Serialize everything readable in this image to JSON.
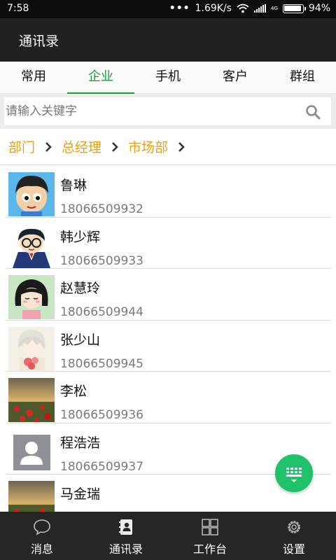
{
  "status_bar": {
    "time": "7:58",
    "dots": "•••",
    "speed": "1.69K/s",
    "network": "4G",
    "battery_text": "94%",
    "battery_level": 0.94
  },
  "header": {
    "title": "通讯录"
  },
  "tabs": [
    {
      "label": "常用",
      "active": false
    },
    {
      "label": "企业",
      "active": true
    },
    {
      "label": "手机",
      "active": false
    },
    {
      "label": "客户",
      "active": false
    },
    {
      "label": "群组",
      "active": false
    }
  ],
  "search": {
    "placeholder": "请输入关键字",
    "value": "",
    "icon": "search-icon"
  },
  "breadcrumb": {
    "items": [
      "部门",
      "总经理",
      "市场部"
    ],
    "separator_icon": "chevron-right-icon",
    "color": "#e6a118"
  },
  "contacts": [
    {
      "name": "鲁琳",
      "phone": "18066509932",
      "avatar": "cartoon-boy-avatar"
    },
    {
      "name": "韩少辉",
      "phone": "18066509933",
      "avatar": "cartoon-detective-avatar"
    },
    {
      "name": "赵慧玲",
      "phone": "18066509944",
      "avatar": "cartoon-girl-avatar"
    },
    {
      "name": "张少山",
      "phone": "18066509945",
      "avatar": "anime-boy-flowers-avatar"
    },
    {
      "name": "李松",
      "phone": "18066509936",
      "avatar": "poppy-field-avatar"
    },
    {
      "name": "程浩浩",
      "phone": "18066509937",
      "avatar": "default-user-avatar"
    },
    {
      "name": "马金瑞",
      "phone": "",
      "avatar": "poppy-field-avatar"
    }
  ],
  "fab": {
    "icon": "keyboard-icon",
    "color": "#1fc16b"
  },
  "bottom_nav": [
    {
      "label": "消息",
      "icon": "chat-bubble-icon"
    },
    {
      "label": "通讯录",
      "icon": "address-book-icon"
    },
    {
      "label": "工作台",
      "icon": "grid-icon"
    },
    {
      "label": "设置",
      "icon": "gear-icon"
    }
  ],
  "colors": {
    "accent": "#1c9a3c",
    "title_bar": "#212121",
    "bottom_bar": "#262626"
  }
}
